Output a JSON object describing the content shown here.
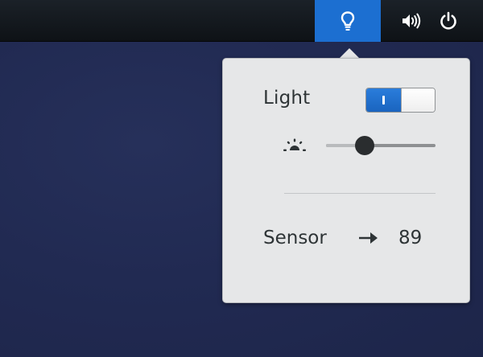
{
  "topbar": {
    "indicators": [
      {
        "icon": "lightbulb-icon",
        "active": true
      },
      {
        "icon": "volume-icon",
        "active": false
      },
      {
        "icon": "power-icon",
        "active": false
      }
    ],
    "accent_color": "#1c6fd1"
  },
  "popover": {
    "light": {
      "label": "Light",
      "switch_on": true
    },
    "brightness": {
      "icon": "brightness-icon",
      "value": 0.35
    },
    "sensor": {
      "label": "Sensor",
      "arrow": "→",
      "value": "89"
    }
  }
}
